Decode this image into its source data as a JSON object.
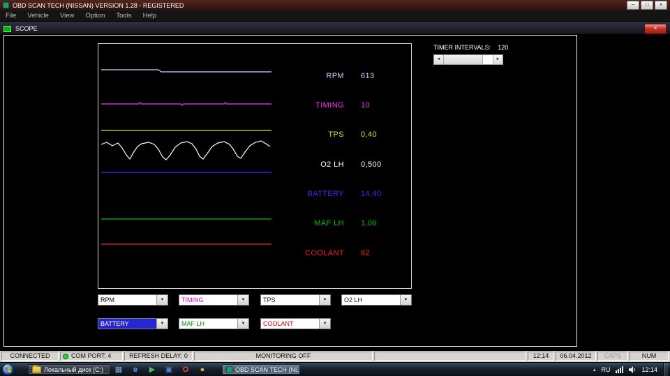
{
  "icons": {
    "minimize": "–",
    "maximize": "□",
    "close": "×",
    "dropdown": "▼",
    "scroll_left": "◄",
    "scroll_right": "►",
    "tray_expand": "▴"
  },
  "window": {
    "title": "OBD SCAN TECH (NISSAN) VERSION 1.28 - REGISTERED",
    "menu": [
      "File",
      "Vehicle",
      "View",
      "Option",
      "Tools",
      "Help"
    ]
  },
  "scope": {
    "title": "SCOPE",
    "timer_label": "TIMER INTERVALS:",
    "timer_value": "120",
    "channels": [
      {
        "label": "RPM",
        "value": "613",
        "color": "#d6d0fa"
      },
      {
        "label": "TIMING",
        "value": "10",
        "color": "#ff35ff"
      },
      {
        "label": "TPS",
        "value": "0,40",
        "color": "#dede3a"
      },
      {
        "label": "O2 LH",
        "value": "0,500",
        "color": "#ffffff"
      },
      {
        "label": "BATTERY",
        "value": "14,40",
        "color": "#3434f0"
      },
      {
        "label": "MAF LH",
        "value": "1,06",
        "color": "#00c000"
      },
      {
        "label": "COOLANT",
        "value": "82",
        "color": "#f02020"
      }
    ],
    "combos": [
      {
        "label": "RPM",
        "text": "#000000",
        "bg": "#ffffff"
      },
      {
        "label": "TIMING",
        "text": "#d800d8",
        "bg": "#ffffff"
      },
      {
        "label": "TPS",
        "text": "#1a1a1a",
        "bg": "#ffffff"
      },
      {
        "label": "O2 LH",
        "text": "#1a1a1a",
        "bg": "#ffffff"
      },
      {
        "label": "BATTERY",
        "text": "#ffffff",
        "bg": "#2626d2"
      },
      {
        "label": "MAF LH",
        "text": "#009000",
        "bg": "#ffffff"
      },
      {
        "label": "COOLANT",
        "text": "#d40000",
        "bg": "#ffffff"
      }
    ]
  },
  "statusbar": {
    "connection": "CONNECTED",
    "com_port": "COM PORT:  4",
    "refresh_delay": "REFRESH DELAY:  0",
    "monitoring": "MONITORING OFF",
    "time": "12:14",
    "date": "06.04.2012",
    "caps": "CAPS",
    "num": "NUM",
    "led_color": "#30d030"
  },
  "taskbar": {
    "explorer_window": "Локальный диск (C:)",
    "active_window": "OBD SCAN TECH (NI...",
    "language": "RU",
    "clock": "12:14",
    "pinned": [
      {
        "glyph": "▦",
        "color": "#7fa8e0"
      },
      {
        "glyph": "e",
        "color": "#54aaf2"
      },
      {
        "glyph": "▶",
        "color": "#5cb85c"
      },
      {
        "glyph": "▣",
        "color": "#4f7fe0"
      },
      {
        "glyph": "O",
        "color": "#e8503a"
      },
      {
        "glyph": "●",
        "color": "#f0a83a"
      }
    ]
  }
}
